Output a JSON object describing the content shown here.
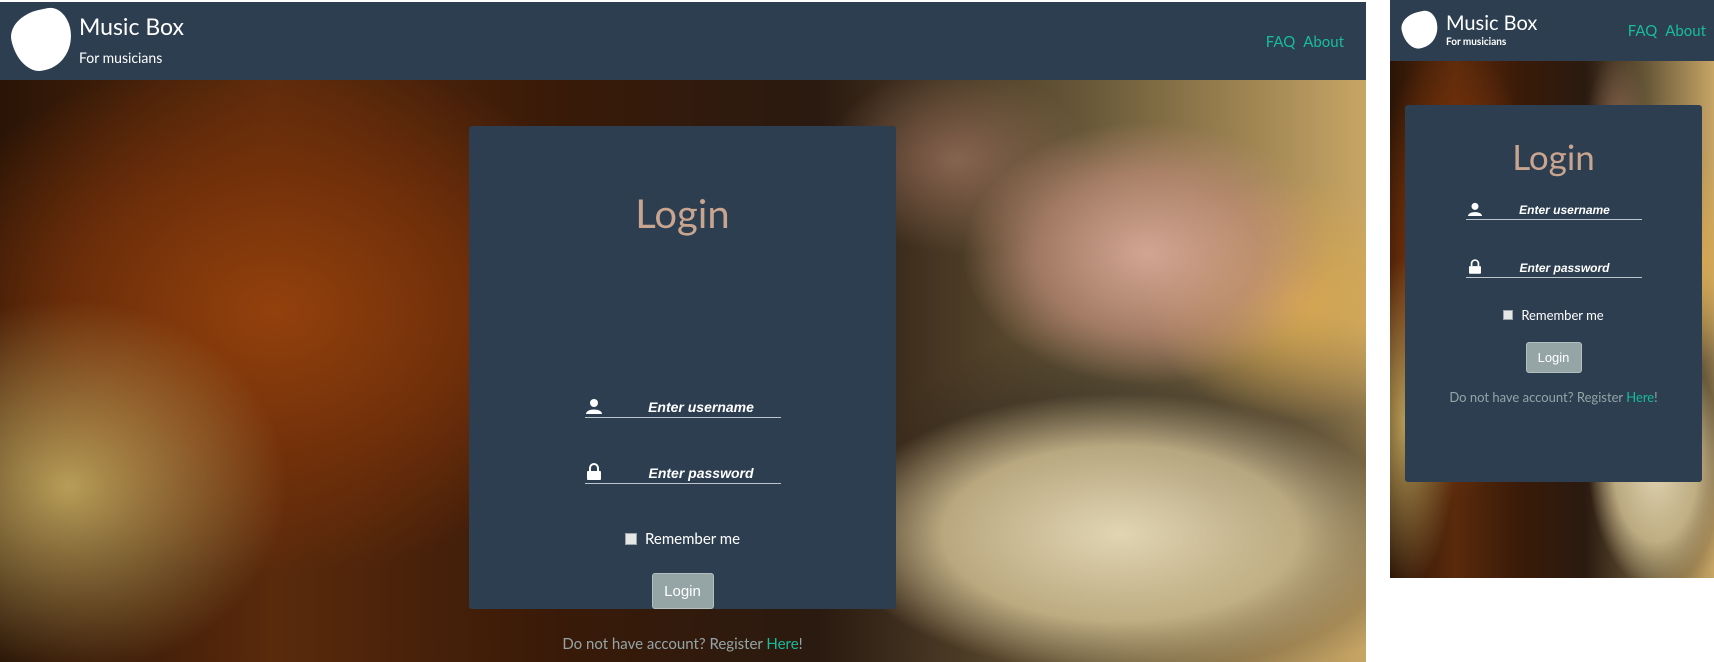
{
  "brand": {
    "title": "Music Box",
    "subtitle": "For musicians"
  },
  "nav": {
    "faq": "FAQ",
    "about": "About"
  },
  "login": {
    "title": "Login",
    "username_placeholder": "Enter username",
    "password_placeholder": "Enter password",
    "remember_label": "Remember me",
    "remember_checked": false,
    "button_label": "Login",
    "register_prefix": "Do not have account? Register ",
    "register_link": "Here",
    "register_suffix": "!"
  },
  "icons": {
    "logo": "guitar-pick-icon",
    "username": "user-icon",
    "password": "lock-icon"
  },
  "colors": {
    "navbar": "#2c3e50",
    "card": "#2c3e50",
    "accent": "#18bc9c",
    "title": "#c9a58f",
    "button": "#95a5a6"
  }
}
